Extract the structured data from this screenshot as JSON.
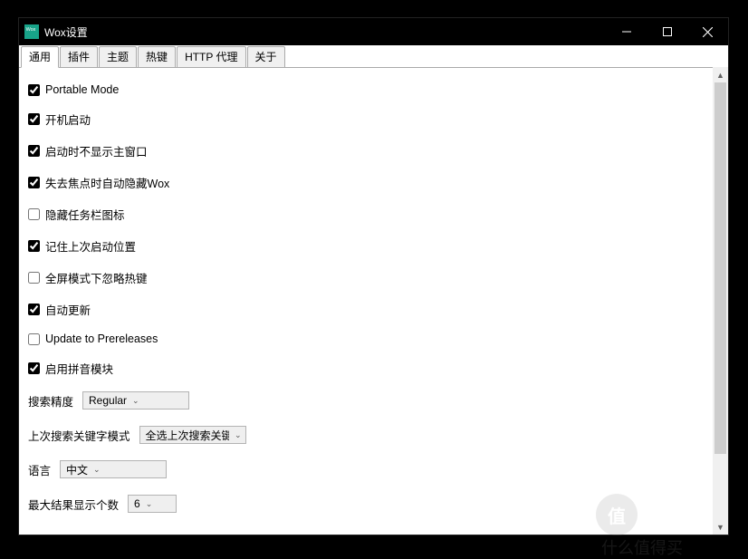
{
  "window": {
    "title": "Wox设置"
  },
  "tabs": {
    "items": [
      "通用",
      "插件",
      "主题",
      "热键",
      "HTTP 代理",
      "关于"
    ],
    "active_index": 0
  },
  "checkboxes": [
    {
      "label": "Portable Mode",
      "checked": true
    },
    {
      "label": "开机启动",
      "checked": true
    },
    {
      "label": "启动时不显示主窗口",
      "checked": true
    },
    {
      "label": "失去焦点时自动隐藏Wox",
      "checked": true
    },
    {
      "label": "隐藏任务栏图标",
      "checked": false
    },
    {
      "label": "记住上次启动位置",
      "checked": true
    },
    {
      "label": "全屏模式下忽略热键",
      "checked": false
    },
    {
      "label": "自动更新",
      "checked": true
    },
    {
      "label": "Update to Prereleases",
      "checked": false
    },
    {
      "label": "启用拼音模块",
      "checked": true
    }
  ],
  "form": {
    "search_precision": {
      "label": "搜索精度",
      "value": "Regular",
      "width": 118
    },
    "last_keyword_mode": {
      "label": "上次搜索关键字模式",
      "value": "全选上次搜索关键",
      "width": 118
    },
    "language": {
      "label": "语言",
      "value": "中文",
      "width": 118
    },
    "max_results": {
      "label": "最大结果显示个数",
      "value": "6",
      "width": 54
    }
  },
  "watermark": "什么值得买"
}
